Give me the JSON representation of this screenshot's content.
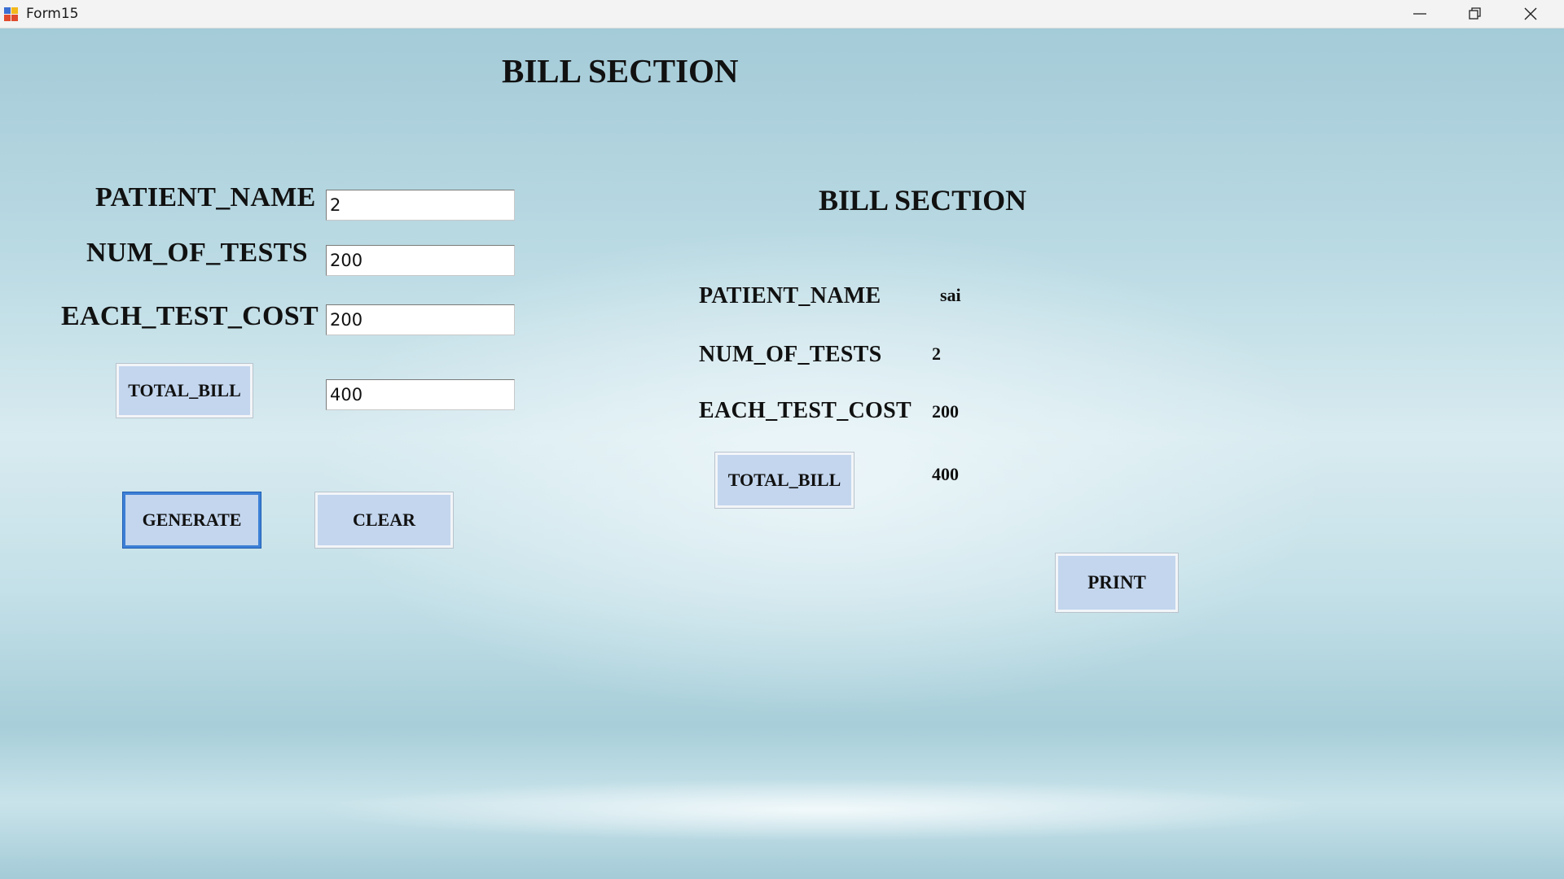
{
  "window": {
    "title": "Form15"
  },
  "colors": {
    "button_bg": "#c3d6ee",
    "background": "#a2c9d5"
  },
  "icons": {
    "app": "form-app-icon",
    "minimize": "minimize-icon",
    "restore": "restore-icon",
    "close": "close-icon"
  },
  "main_heading": "BILL SECTION",
  "entry": {
    "patient_name_label": "PATIENT_NAME",
    "patient_name_value": "2",
    "num_tests_label": "NUM_OF_TESTS",
    "num_tests_value": "200",
    "each_cost_label": "EACH_TEST_COST",
    "each_cost_value": "200",
    "total_bill_button": "TOTAL_BILL",
    "total_bill_value": "400",
    "generate_button": "GENERATE",
    "clear_button": "CLEAR"
  },
  "bill": {
    "heading": "BILL SECTION",
    "patient_name_label": "PATIENT_NAME",
    "patient_name_value": "sai",
    "num_tests_label": "NUM_OF_TESTS",
    "num_tests_value": "2",
    "each_cost_label": "EACH_TEST_COST",
    "each_cost_value": "200",
    "total_bill_button": "TOTAL_BILL",
    "total_bill_value": "400",
    "print_button": "PRINT"
  }
}
